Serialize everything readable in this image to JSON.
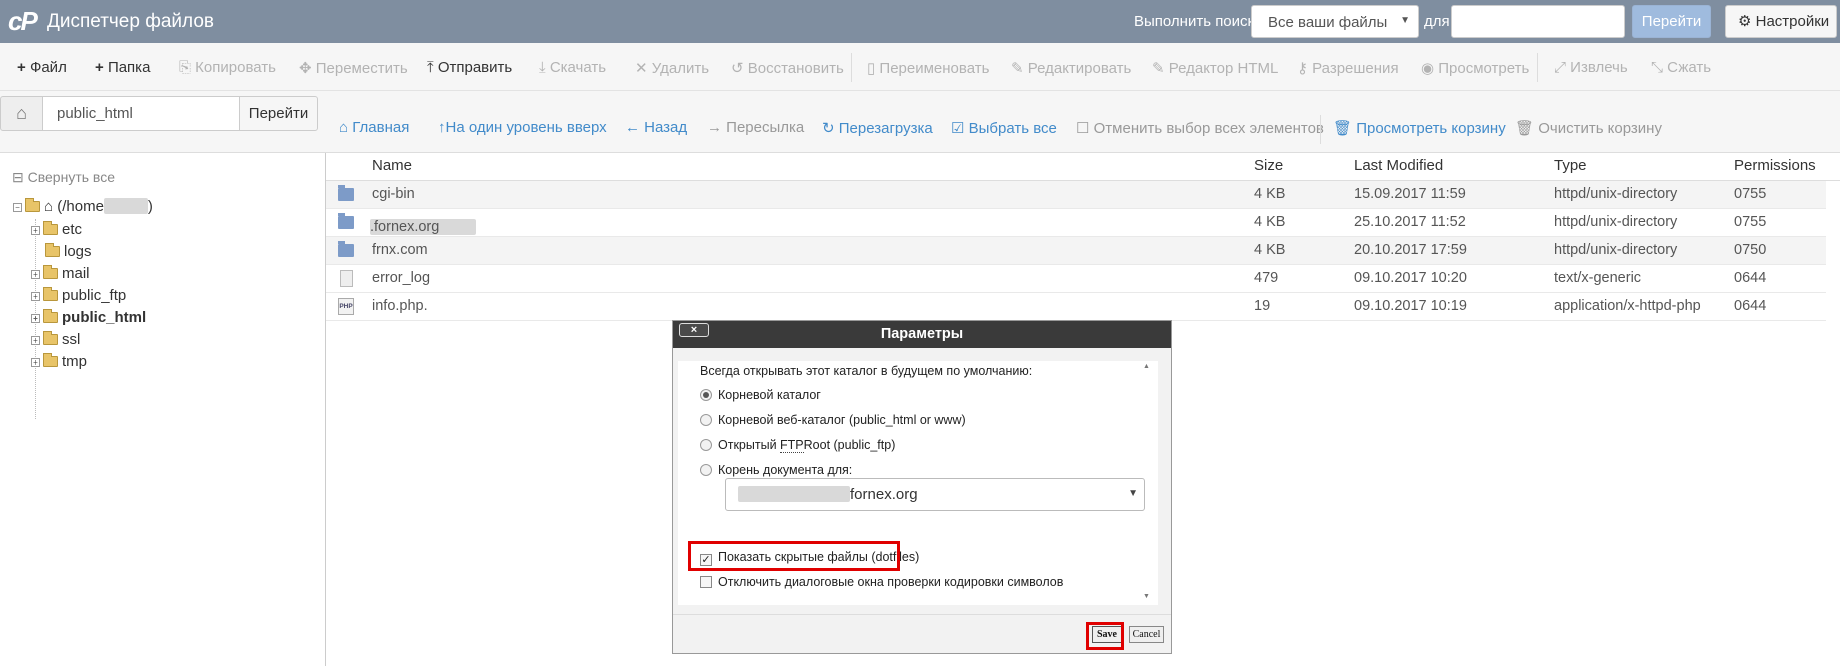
{
  "header": {
    "logo_text": "cP",
    "title": "Диспетчер файлов",
    "search_label": "Выполнить поиск",
    "search_scope": "Все ваши файлы",
    "for_label": "для",
    "search_value": "",
    "go_label": "Перейти",
    "settings_label": "Настройки"
  },
  "toolbar": {
    "file": "Файл",
    "folder": "Папка",
    "copy": "Копировать",
    "move": "Переместить",
    "upload": "Отправить",
    "download": "Скачать",
    "delete": "Удалить",
    "restore": "Восстановить",
    "rename": "Переименовать",
    "edit": "Редактировать",
    "html_editor": "Редактор HTML",
    "permissions": "Разрешения",
    "view": "Просмотреть",
    "extract": "Извлечь",
    "compress": "Сжать"
  },
  "pathbar": {
    "path_value": "public_html",
    "go_label": "Перейти",
    "home": "Главная",
    "up": "На один уровень вверх",
    "back": "Назад",
    "forward": "Пересылка",
    "reload": "Перезагрузка",
    "select_all": "Выбрать все",
    "deselect_all": "Отменить выбор всех элементов",
    "view_trash": "Просмотреть корзину",
    "empty_trash": "Очистить корзину"
  },
  "sidebar": {
    "collapse_all": "Свернуть все",
    "root_label_start": "(/home",
    "root_label_end": ")",
    "items": [
      {
        "label": "etc"
      },
      {
        "label": "logs"
      },
      {
        "label": "mail"
      },
      {
        "label": "public_ftp"
      },
      {
        "label": "public_html"
      },
      {
        "label": "ssl"
      },
      {
        "label": "tmp"
      }
    ]
  },
  "table": {
    "columns": [
      "Name",
      "Size",
      "Last Modified",
      "Type",
      "Permissions"
    ],
    "rows": [
      {
        "name": "cgi-bin",
        "size": "4 KB",
        "modified": "15.09.2017 11:59",
        "type": "httpd/unix-directory",
        "perms": "0755"
      },
      {
        "name": ".fornex.org",
        "size": "4 KB",
        "modified": "25.10.2017 11:52",
        "type": "httpd/unix-directory",
        "perms": "0755"
      },
      {
        "name": "frnx.com",
        "size": "4 KB",
        "modified": "20.10.2017 17:59",
        "type": "httpd/unix-directory",
        "perms": "0750"
      },
      {
        "name": "error_log",
        "size": "479",
        "modified": "09.10.2017 10:20",
        "type": "text/x-generic",
        "perms": "0644"
      },
      {
        "name": "info.php.",
        "size": "19",
        "modified": "09.10.2017 10:19",
        "type": "application/x-httpd-php",
        "perms": "0644"
      }
    ]
  },
  "dialog": {
    "title": "Параметры",
    "close": "×",
    "prompt": "Всегда открывать этот каталог в будущем по умолчанию:",
    "opt_root": "Корневой каталог",
    "opt_web_root": "Корневой веб-каталог (public_html or www)",
    "opt_ftp_1": "Открытый",
    "opt_ftp_abbr": "FTP",
    "opt_ftp_2": "Root (public_ftp)",
    "opt_docroot": "Корень документа для:",
    "docroot_value": "fornex.org",
    "show_hidden": "Показать скрытые файлы (dotfiles)",
    "disable_charset": "Отключить диалоговые окна проверки кодировки символов",
    "save": "Save",
    "cancel": "Cancel"
  }
}
